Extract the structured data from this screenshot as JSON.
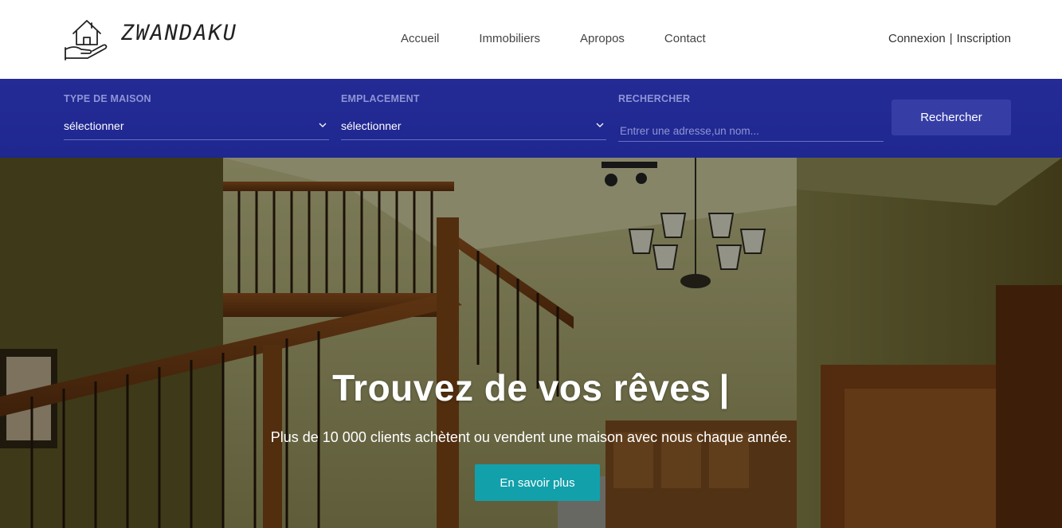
{
  "brand": {
    "name": "ZWANDAKU",
    "icon": "house-in-hand-icon"
  },
  "nav": {
    "items": [
      {
        "label": "Accueil"
      },
      {
        "label": "Immobiliers"
      },
      {
        "label": "Apropos"
      },
      {
        "label": "Contact"
      }
    ]
  },
  "auth": {
    "login": "Connexion",
    "separator": "|",
    "register": "Inscription"
  },
  "search": {
    "type_label": "TYPE DE MAISON",
    "type_value": "sélectionner",
    "location_label": "EMPLACEMENT",
    "location_value": "sélectionner",
    "query_label": "RECHERCHER",
    "query_placeholder": "Entrer une adresse,un nom...",
    "query_value": "",
    "button_label": "Rechercher",
    "chevron_icon": "chevron-down-icon"
  },
  "hero": {
    "title": "Trouvez de vos rêves",
    "caret": "|",
    "subtitle": "Plus de 10 000 clients achètent ou vendent une maison avec nous chaque année.",
    "cta_label": "En savoir plus"
  },
  "colors": {
    "search_bar": "#242b95",
    "search_button": "#363ea6",
    "cta": "#12a0ab",
    "field_label": "#8e95d6"
  }
}
